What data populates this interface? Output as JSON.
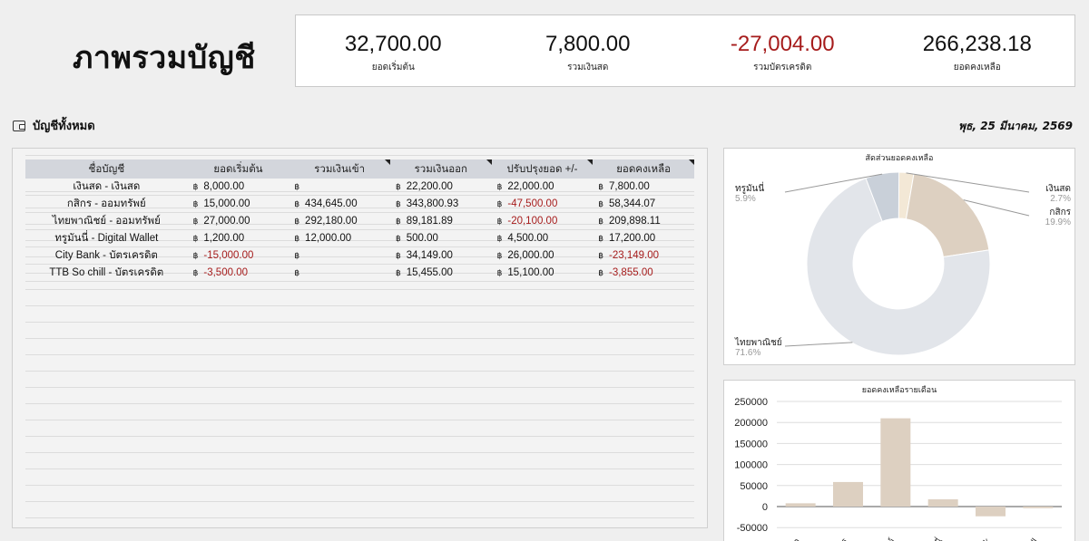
{
  "header": {
    "title": "ภาพรวมบัญชี"
  },
  "summary": [
    {
      "value": "32,700.00",
      "label": "ยอดเริ่มต้น",
      "negative": false
    },
    {
      "value": "7,800.00",
      "label": "รวมเงินสด",
      "negative": false
    },
    {
      "value": "-27,004.00",
      "label": "รวมบัตรเครดิต",
      "negative": true
    },
    {
      "value": "266,238.18",
      "label": "ยอดคงเหลือ",
      "negative": false
    }
  ],
  "section": {
    "title": "บัญชีทั้งหมด",
    "icon": "wallet-icon",
    "date": "พุธ, 25 มีนาคม, 2569"
  },
  "colors": {
    "negative": "#a61c1c",
    "header_bg": "#d3d6dc",
    "pie": [
      "#f3e8d6",
      "#ddd0c1",
      "#e2e5ea",
      "#c9d0d9"
    ],
    "bar": "#ddd0c1"
  },
  "table": {
    "currency": "฿",
    "headers": [
      "ชื่อบัญชี",
      "ยอดเริ่มต้น",
      "รวมเงินเข้า",
      "รวมเงินออก",
      "ปรับปรุงยอด +/-",
      "ยอดคงเหลือ"
    ],
    "rows": [
      [
        "เงินสด - เงินสด",
        "8,000.00",
        "",
        "22,200.00",
        "22,000.00",
        "7,800.00"
      ],
      [
        "กสิกร - ออมทรัพย์",
        "15,000.00",
        "434,645.00",
        "343,800.93",
        "-47,500.00",
        "58,344.07"
      ],
      [
        "ไทยพาณิชย์ - ออมทรัพย์",
        "27,000.00",
        "292,180.00",
        "89,181.89",
        "-20,100.00",
        "209,898.11"
      ],
      [
        "ทรูมันนี่ - Digital Wallet",
        "1,200.00",
        "12,000.00",
        "500.00",
        "4,500.00",
        "17,200.00"
      ],
      [
        "City Bank - บัตรเครดิต",
        "-15,000.00",
        "",
        "34,149.00",
        "26,000.00",
        "-23,149.00"
      ],
      [
        "TTB So chill - บัตรเครดิต",
        "-3,500.00",
        "",
        "15,455.00",
        "15,100.00",
        "-3,855.00"
      ]
    ]
  },
  "chart_data": [
    {
      "type": "pie",
      "title": "สัดส่วนยอดคงเหลือ",
      "slices": [
        {
          "label": "เงินสด",
          "percent": 2.7,
          "pct_label": "2.7%"
        },
        {
          "label": "กสิกร",
          "percent": 19.9,
          "pct_label": "19.9%"
        },
        {
          "label": "ไทยพาณิชย์",
          "percent": 71.6,
          "pct_label": "71.6%"
        },
        {
          "label": "ทรูมันนี่",
          "percent": 5.9,
          "pct_label": "5.9%"
        }
      ]
    },
    {
      "type": "bar",
      "title": "ยอดคงเหลือรายเดือน",
      "categories": [
        "สด",
        "สิกร",
        "ณิชย์",
        "มันนี่",
        "ank",
        "chill"
      ],
      "values": [
        7800.0,
        58344.07,
        209898.11,
        17200.0,
        -23149.0,
        -3855.0
      ],
      "yticks": [
        "250000",
        "200000",
        "150000",
        "100000",
        "50000",
        "0",
        "-50000"
      ],
      "ylim": [
        -50000,
        250000
      ]
    }
  ]
}
